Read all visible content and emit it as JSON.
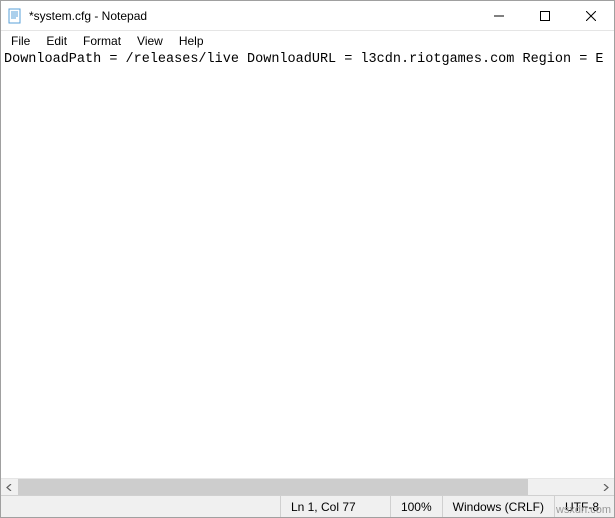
{
  "titlebar": {
    "title": "*system.cfg - Notepad"
  },
  "menu": {
    "file": "File",
    "edit": "Edit",
    "format": "Format",
    "view": "View",
    "help": "Help"
  },
  "content": {
    "text": "DownloadPath = /releases/live DownloadURL = l3cdn.riotgames.com Region = E"
  },
  "status": {
    "position": "Ln 1, Col 77",
    "zoom": "100%",
    "eol": "Windows (CRLF)",
    "encoding": "UTF-8"
  },
  "watermark": "wsxdn.com"
}
